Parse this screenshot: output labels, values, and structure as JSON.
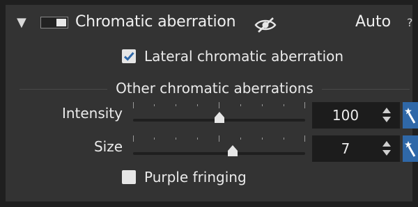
{
  "header": {
    "collapse_glyph": "▼",
    "title": "Chromatic aberration",
    "auto_label": "Auto",
    "help_glyph": "?",
    "enabled": true,
    "visibility_icon": "eye-slashed-icon"
  },
  "options": {
    "lateral": {
      "label": "Lateral chromatic aberration",
      "checked": true
    },
    "purple": {
      "label": "Purple fringing",
      "checked": false
    }
  },
  "section": {
    "label": "Other chromatic aberrations"
  },
  "sliders": [
    {
      "label": "Intensity",
      "value": "100",
      "position": 0.5
    },
    {
      "label": "Size",
      "value": "7",
      "position": 0.58
    }
  ],
  "colors": {
    "accent": "#2f68a8",
    "panel": "#333333",
    "frame": "#1f1f1f"
  }
}
